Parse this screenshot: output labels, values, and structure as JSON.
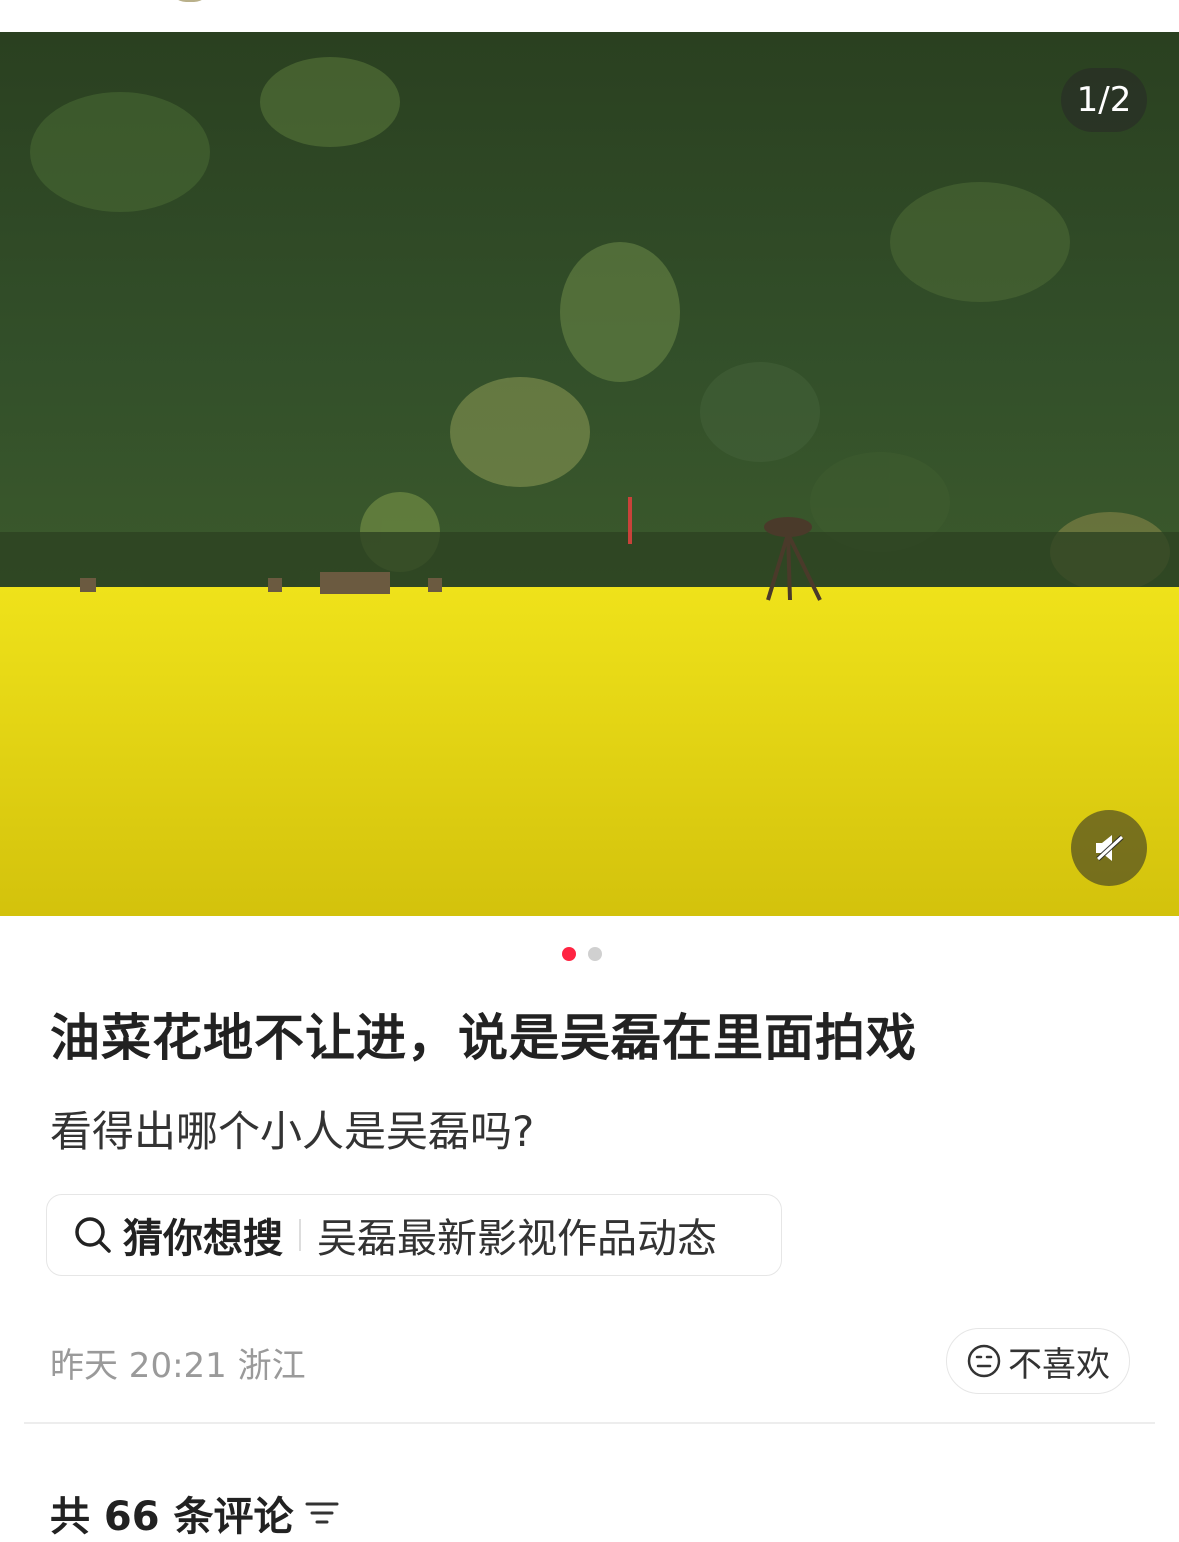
{
  "media": {
    "counter": "1/2",
    "mute_icon": "mute-icon",
    "total_images": 2,
    "current_index": 1
  },
  "post": {
    "title": "油菜花地不让进，说是吴磊在里面拍戏",
    "description": "看得出哪个小人是吴磊吗?",
    "search": {
      "icon": "search-icon",
      "label": "猜你想搜",
      "term": "吴磊最新影视作品动态"
    },
    "meta": "昨天 20:21 浙江",
    "dislike": {
      "icon": "neutral-face-icon",
      "label": "不喜欢"
    }
  },
  "comments": {
    "count_label": "共 66 条评论",
    "sort_icon": "sort-icon"
  },
  "colors": {
    "accent": "#ff2442",
    "field_yellow": "#e3d410",
    "mountain_green": "#2f4a26"
  }
}
